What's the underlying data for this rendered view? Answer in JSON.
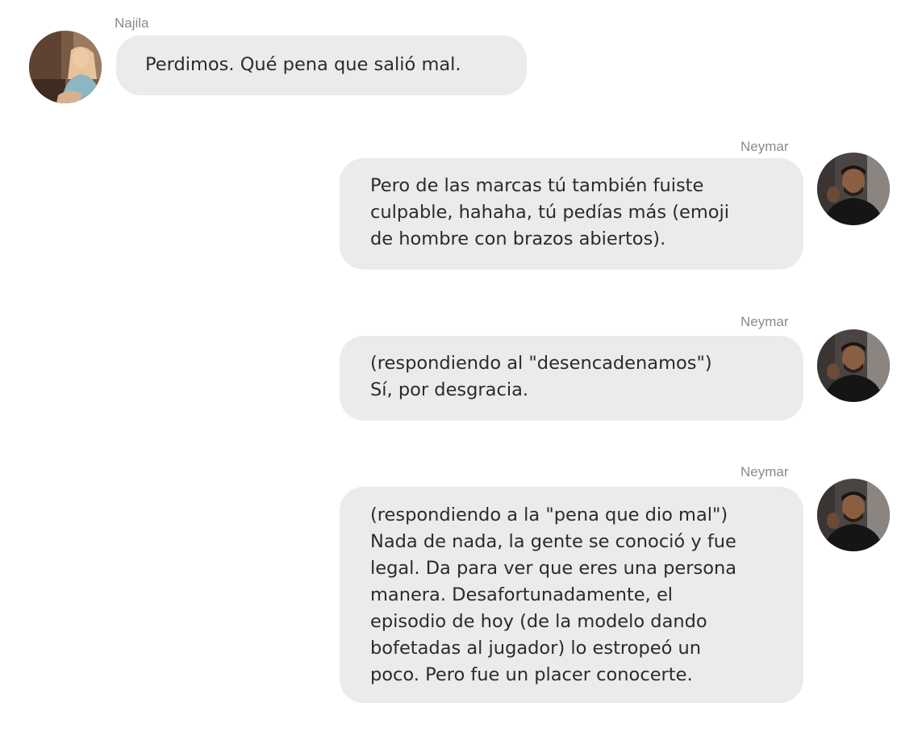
{
  "messages": [
    {
      "sender": "Najila",
      "side": "left",
      "text": "Perdimos. Qué pena que salió mal.",
      "avatar_icon": "woman-avatar-icon"
    },
    {
      "sender": "Neymar",
      "side": "right",
      "text": "Pero de las marcas tú también fuiste\nculpable, hahaha, tú pedías más (emoji\nde hombre con brazos abiertos).",
      "avatar_icon": "man-avatar-icon"
    },
    {
      "sender": "Neymar",
      "side": "right",
      "text": "(respondiendo al \"desencadenamos\")\nSí, por desgracia.",
      "avatar_icon": "man-avatar-icon"
    },
    {
      "sender": "Neymar",
      "side": "right",
      "text": " (respondiendo a la \"pena que dio mal\")\nNada de nada, la gente se conoció y fue\nlegal. Da para ver que eres una persona\nmanera. Desafortunadamente, el\nepisodio de hoy (de la modelo dando\nbofetadas al jugador) lo estropeó un\npoco. Pero fue un placer conocerte.",
      "avatar_icon": "man-avatar-icon"
    }
  ],
  "colors": {
    "bubble": "#ebebeb",
    "sender": "#8a8a8a",
    "text": "#2b2b2b",
    "background": "#ffffff"
  }
}
